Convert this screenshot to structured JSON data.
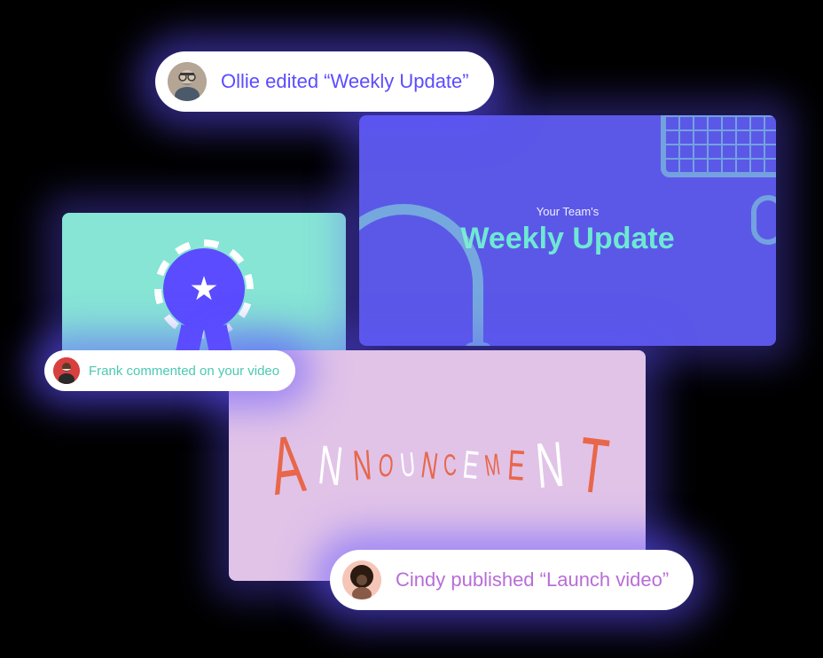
{
  "notifications": {
    "ollie": {
      "text": "Ollie edited “Weekly Update”"
    },
    "frank": {
      "text": "Frank commented on your video"
    },
    "cindy": {
      "text": "Cindy published “Launch video”"
    }
  },
  "cards": {
    "weekly": {
      "subtitle": "Your Team's",
      "title": "Weekly Update"
    },
    "announcement": {
      "word": "ANNOUNCEMENT"
    }
  },
  "announce_letters": [
    {
      "ch": "A",
      "color": "#e8674a",
      "fs": 92,
      "rot": -8
    },
    {
      "ch": "N",
      "color": "#fff",
      "fs": 62,
      "rot": 6
    },
    {
      "ch": "N",
      "color": "#e8674a",
      "fs": 48,
      "rot": -4
    },
    {
      "ch": "O",
      "color": "#e8674a",
      "fs": 36,
      "rot": 5
    },
    {
      "ch": "U",
      "color": "#fff",
      "fs": 38,
      "rot": -6
    },
    {
      "ch": "N",
      "color": "#e8674a",
      "fs": 42,
      "rot": 8
    },
    {
      "ch": "C",
      "color": "#e8674a",
      "fs": 34,
      "rot": -3
    },
    {
      "ch": "E",
      "color": "#fff",
      "fs": 44,
      "rot": 6
    },
    {
      "ch": "M",
      "color": "#e8674a",
      "fs": 34,
      "rot": -8
    },
    {
      "ch": "E",
      "color": "#e8674a",
      "fs": 48,
      "rot": 4
    },
    {
      "ch": "N",
      "color": "#fff",
      "fs": 72,
      "rot": -5
    },
    {
      "ch": "T",
      "color": "#e8674a",
      "fs": 88,
      "rot": 7
    }
  ]
}
